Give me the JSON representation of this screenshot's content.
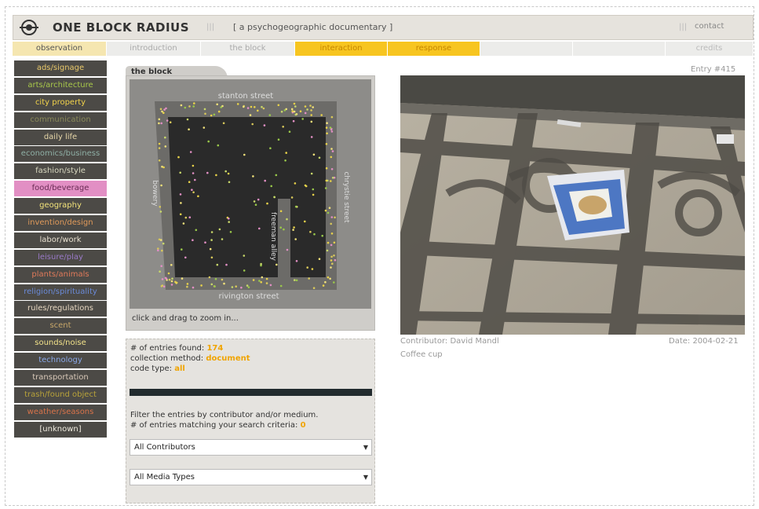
{
  "header": {
    "title": "ONE BLOCK RADIUS",
    "separator": "|||",
    "tagline": "[ a psychogeographic documentary ]",
    "contact_label": "contact"
  },
  "nav": {
    "tabs": [
      "observation",
      "introduction",
      "the block",
      "interaction",
      "response",
      "",
      "",
      "credits"
    ]
  },
  "sidebar": {
    "items": [
      {
        "label": "ads/signage",
        "color": "#e8c86a"
      },
      {
        "label": "arts/architecture",
        "color": "#a8c84a"
      },
      {
        "label": "city property",
        "color": "#f2d24a"
      },
      {
        "label": "communication",
        "color": "#8a8a5a"
      },
      {
        "label": "daily life",
        "color": "#e6d6a8"
      },
      {
        "label": "economics/business",
        "color": "#8fb0a6"
      },
      {
        "label": "fashion/style",
        "color": "#d8d8c0"
      },
      {
        "label": "food/beverage",
        "color": "#6a2d55",
        "active": true
      },
      {
        "label": "geography",
        "color": "#f2e27a"
      },
      {
        "label": "invention/design",
        "color": "#e09a5a"
      },
      {
        "label": "labor/work",
        "color": "#e8e0d0"
      },
      {
        "label": "leisure/play",
        "color": "#9a7ac8"
      },
      {
        "label": "plants/animals",
        "color": "#e07a5a"
      },
      {
        "label": "religion/spirituality",
        "color": "#6a8ad8"
      },
      {
        "label": "rules/regulations",
        "color": "#e6d6c0"
      },
      {
        "label": "scent",
        "color": "#c8a86a"
      },
      {
        "label": "sounds/noise",
        "color": "#f2e28a"
      },
      {
        "label": "technology",
        "color": "#8aa8e8"
      },
      {
        "label": "transportation",
        "color": "#d8c8b8"
      },
      {
        "label": "trash/found object",
        "color": "#b8a23a"
      },
      {
        "label": "weather/seasons",
        "color": "#d8734a"
      },
      {
        "label": "[unknown]",
        "color": "#f0ece0"
      }
    ]
  },
  "block": {
    "tab_label": "the block",
    "streets": {
      "north": "stanton street",
      "south": "rivington street",
      "west": "bowery",
      "east": "chrystie street",
      "alley": "freeman alley"
    },
    "hint": "click and drag to zoom in..."
  },
  "info": {
    "entries_found_label": "# of entries found:",
    "entries_found_value": "174",
    "collection_label": "collection method:",
    "collection_value": "document",
    "code_label": "code type:",
    "code_value": "all",
    "filter_text": "Filter the entries by contributor and/or medium.",
    "matching_label": "# of entries matching your search criteria:",
    "matching_value": "0",
    "contributors_select": "All Contributors",
    "media_select": "All Media Types"
  },
  "entry": {
    "number": "Entry #415",
    "contributor": "Contributor: David Mandl",
    "date": "Date: 2004-02-21",
    "caption": "Coffee cup"
  },
  "colors": {
    "accent": "#f7c520",
    "sidebar_bg": "#4c4a46",
    "active_item": "#e28fc4"
  }
}
